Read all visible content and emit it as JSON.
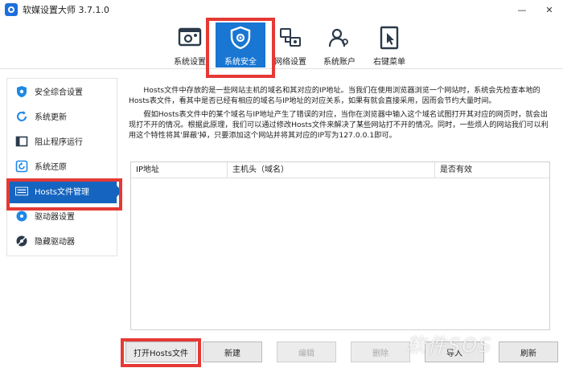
{
  "window": {
    "title": "软媒设置大师 3.7.1.0",
    "min_glyph": "—",
    "close_glyph": "✕"
  },
  "toolbar": {
    "items": [
      {
        "label": "系统设置"
      },
      {
        "label": "系统安全"
      },
      {
        "label": "网络设置"
      },
      {
        "label": "系统账户"
      },
      {
        "label": "右键菜单"
      }
    ],
    "active": "系统安全"
  },
  "sidebar": {
    "items": [
      {
        "label": "安全综合设置"
      },
      {
        "label": "系统更新"
      },
      {
        "label": "阻止程序运行"
      },
      {
        "label": "系统还原"
      },
      {
        "label": "Hosts文件管理"
      },
      {
        "label": "驱动器设置"
      },
      {
        "label": "隐藏驱动器"
      }
    ],
    "active": "Hosts文件管理"
  },
  "description": {
    "para1": "Hosts文件中存放的是一些网站主机的域名和其对应的IP地址。当我们在使用浏览器浏览一个网站时，系统会先检查本地的Hosts表文件，看其中是否已经有相应的域名与IP地址的对应关系，如果有就会直接采用，因而会节约大量时间。",
    "para2": "假如Hosts表文件中的某个域名与IP地址产生了错误的对应，当你在浏览器中输入这个域名试图打开其对应的网页时，就会出现打不开的情况。根据此原理，我们可以通过修改Hosts文件来解决了某些网站打不开的情况。同时，一些烦人的网站我们可以利用这个特性将其'屏蔽'掉，只要添加这个网站并将其对应的IP写为127.0.0.1即可。"
  },
  "table": {
    "columns": [
      "IP地址",
      "主机头（域名）",
      "是否有效"
    ],
    "rows": []
  },
  "buttons": {
    "open_hosts": "打开Hosts文件",
    "new": "新建",
    "edit": "编辑",
    "delete": "删除",
    "import": "导入",
    "refresh": "刷新"
  },
  "watermark": "软件SOS",
  "colors": {
    "accent": "#1976d2",
    "highlight": "#e53935"
  }
}
